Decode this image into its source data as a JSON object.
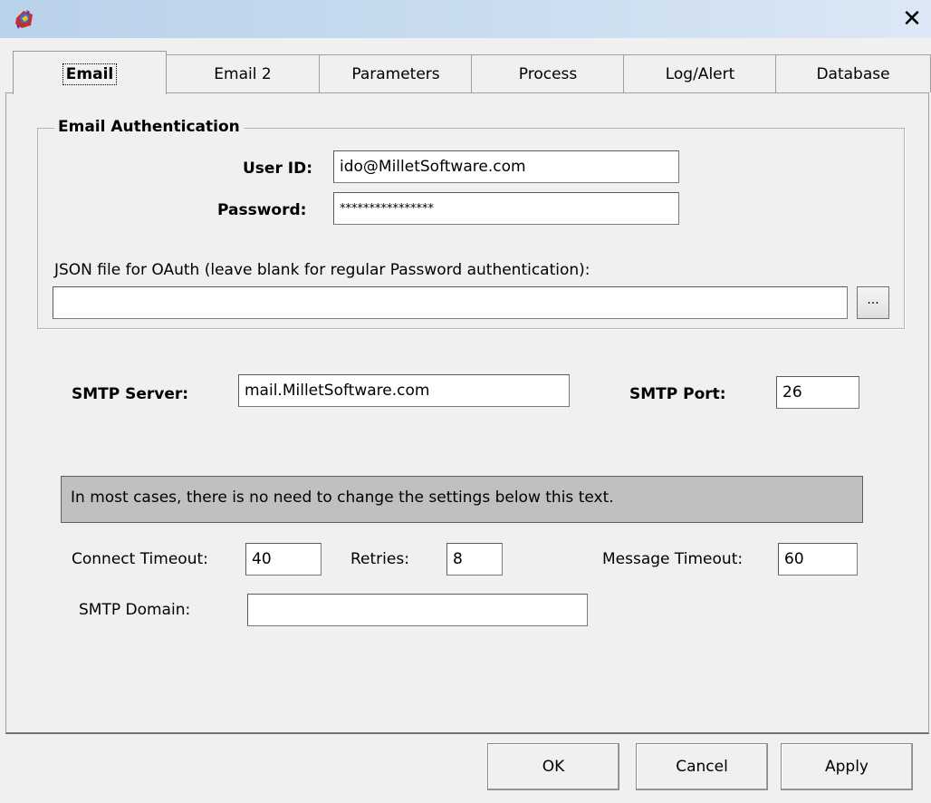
{
  "titlebar": {
    "app_icon": "app-icon",
    "close_label": "✕"
  },
  "tabs": [
    {
      "label": "Email",
      "active": true
    },
    {
      "label": "Email 2",
      "active": false
    },
    {
      "label": "Parameters",
      "active": false
    },
    {
      "label": "Process",
      "active": false
    },
    {
      "label": "Log/Alert",
      "active": false
    },
    {
      "label": "Database",
      "active": false
    }
  ],
  "email_auth": {
    "group_title": "Email Authentication",
    "user_id_label": "User ID:",
    "user_id_value": "ido@MilletSoftware.com",
    "password_label": "Password:",
    "password_value": "****************",
    "json_label": "JSON file for OAuth (leave blank for regular Password authentication):",
    "json_value": "",
    "browse_label": "..."
  },
  "smtp": {
    "server_label": "SMTP Server:",
    "server_value": "mail.MilletSoftware.com",
    "port_label": "SMTP Port:",
    "port_value": "26"
  },
  "note": "In most cases, there is no need to change the settings below this text.",
  "advanced": {
    "connect_timeout_label": "Connect Timeout:",
    "connect_timeout_value": "40",
    "retries_label": "Retries:",
    "retries_value": "8",
    "message_timeout_label": "Message Timeout:",
    "message_timeout_value": "60",
    "smtp_domain_label": "SMTP Domain:",
    "smtp_domain_value": ""
  },
  "buttons": {
    "ok": "OK",
    "cancel": "Cancel",
    "apply": "Apply"
  }
}
